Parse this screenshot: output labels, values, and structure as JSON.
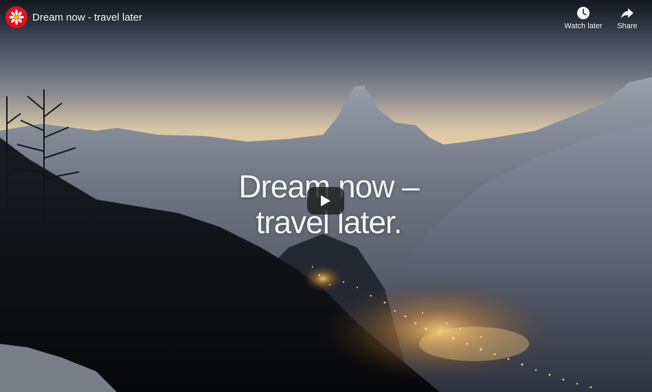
{
  "video": {
    "title": "Dream now - travel later",
    "overlay_line1": "Dream now –",
    "overlay_line2": "travel later."
  },
  "channel": {
    "logo_icon": "edelweiss-icon",
    "brand_color": "#e3111b"
  },
  "actions": {
    "watch_later": {
      "label": "Watch later",
      "icon": "clock-icon"
    },
    "share": {
      "label": "Share",
      "icon": "share-arrow-icon"
    }
  },
  "player": {
    "play_icon": "play-icon"
  }
}
